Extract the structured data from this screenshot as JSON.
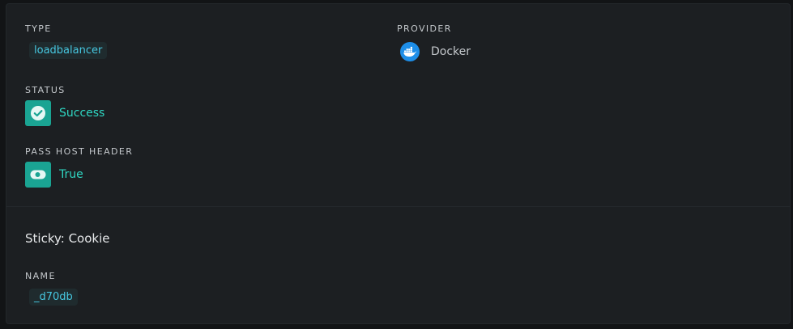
{
  "overview": {
    "type": {
      "label": "TYPE",
      "value": "loadbalancer"
    },
    "provider": {
      "label": "PROVIDER",
      "value": "Docker",
      "icon": "docker-icon"
    },
    "status": {
      "label": "STATUS",
      "value": "Success",
      "icon": "check-circle-icon",
      "color": "#1aa493"
    },
    "pass_host_header": {
      "label": "PASS HOST HEADER",
      "value": "True",
      "icon": "toggle-on-icon",
      "color": "#1aa493"
    }
  },
  "sticky": {
    "heading": "Sticky: Cookie",
    "name": {
      "label": "NAME",
      "value": "_d70db"
    }
  },
  "colors": {
    "accent_teal": "#1aa493",
    "chip_text": "#46c7e0",
    "docker_blue": "#1d8ee8"
  }
}
